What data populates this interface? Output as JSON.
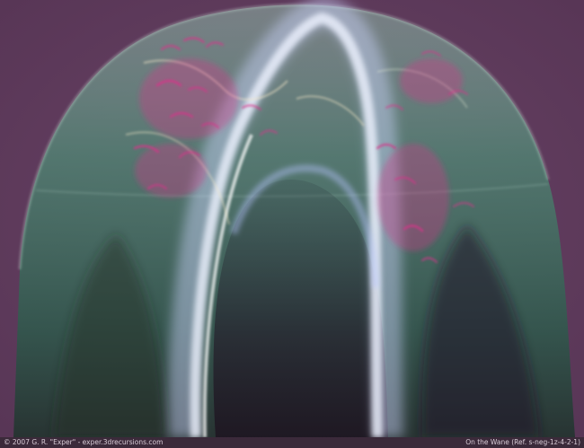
{
  "artwork": {
    "credit": "© 2007 G. R. \"Exper\" - exper.3drecursions.com",
    "title_ref": "On the Wane (Ref. s-neg-1z-4-2-1)",
    "colors": {
      "background": "#5e3a5a",
      "dome_green": "#4e8a74",
      "glow_white": "#dde6ff",
      "accent_magenta": "#d0307f",
      "caption_bar": "#3b2a3a"
    }
  }
}
